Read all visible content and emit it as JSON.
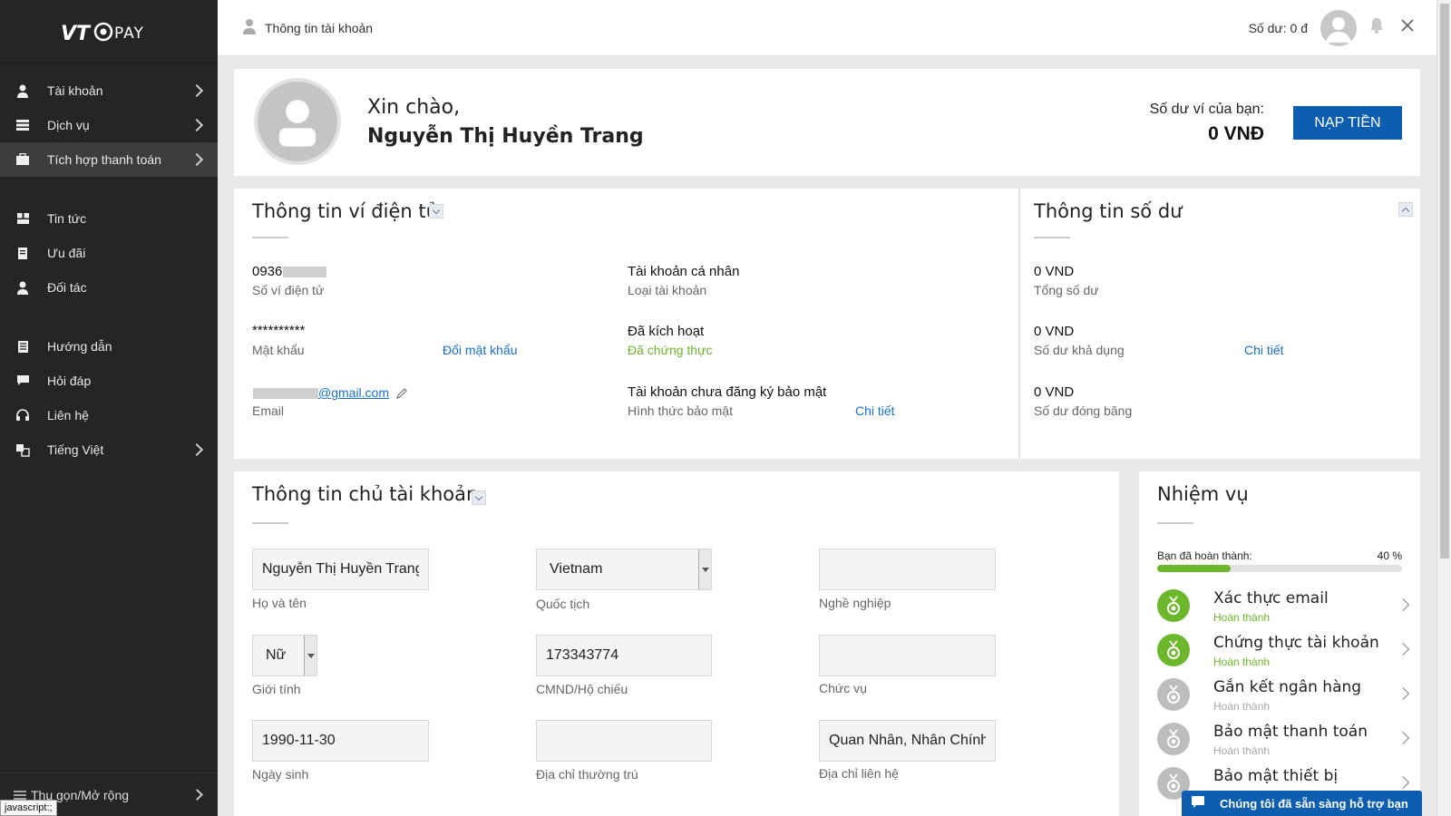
{
  "app": {
    "logo_text": "VTC PAY"
  },
  "sidebar": {
    "groups": [
      [
        {
          "label": "Tài khoản",
          "icon": "user-icon",
          "has_submenu": true
        },
        {
          "label": "Dịch vụ",
          "icon": "services-icon",
          "has_submenu": true
        },
        {
          "label": "Tích hợp thanh toán",
          "icon": "briefcase-icon",
          "has_submenu": true,
          "active": true
        }
      ],
      [
        {
          "label": "Tin tức",
          "icon": "news-icon"
        },
        {
          "label": "Ưu đãi",
          "icon": "coupon-icon"
        },
        {
          "label": "Đối tác",
          "icon": "partner-icon"
        }
      ],
      [
        {
          "label": "Hướng dẫn",
          "icon": "book-icon"
        },
        {
          "label": "Hỏi đáp",
          "icon": "chat-icon"
        },
        {
          "label": "Liên hệ",
          "icon": "headset-icon"
        },
        {
          "label": "Tiếng Việt",
          "icon": "language-icon",
          "has_submenu": true
        }
      ]
    ],
    "collapse_label": "Thu gọn/Mở rộng"
  },
  "status_bar": "javascript:;",
  "topbar": {
    "breadcrumb": "Thông tin tài khoản",
    "balance": "Số dư: 0 đ"
  },
  "welcome": {
    "greeting": "Xin chào,",
    "name": "Nguyễn Thị Huyền Trang",
    "wallet_label": "Số dư ví của bạn:",
    "wallet_value": "0 VNĐ",
    "topup_label": "NẠP TIỀN"
  },
  "wallet_info": {
    "title": "Thông tin ví điện tử",
    "phone_prefix": "0936",
    "phone_label": "Số ví điện tử",
    "password_value": "**********",
    "password_label": "Mật khẩu",
    "change_password_link": "Đổi mật khẩu",
    "email_suffix": "@gmail.com",
    "email_label": "Email",
    "account_type_value": "Tài khoản cá nhân",
    "account_type_label": "Loại tài khoản",
    "activation_value": "Đã kích hoạt",
    "activation_label": "Đã chứng thực",
    "security_value": "Tài khoản chưa đăng ký bảo mật",
    "security_label": "Hình thức bảo mật",
    "security_link": "Chi tiết"
  },
  "balance_info": {
    "title": "Thông tin số dư",
    "total_value": "0 VND",
    "total_label": "Tổng số dư",
    "available_value": "0 VND",
    "available_label": "Số dư khả dụng",
    "available_link": "Chi tiết",
    "frozen_value": "0 VND",
    "frozen_label": "Số dư đóng băng"
  },
  "owner_info": {
    "title": "Thông tin chủ tài khoản",
    "full_name_value": "Nguyễn Thị Huyền Trang",
    "full_name_label": "Họ và tên",
    "nationality_value": "Vietnam",
    "nationality_label": "Quốc tịch",
    "occupation_value": "",
    "occupation_label": "Nghề nghiệp",
    "gender_value": "Nữ",
    "gender_label": "Giới tính",
    "id_value": "173343774",
    "id_label": "CMND/Hộ chiếu",
    "position_value": "",
    "position_label": "Chức vụ",
    "dob_value": "1990-11-30",
    "dob_label": "Ngày sinh",
    "permanent_address_value": "",
    "permanent_address_label": "Địa chỉ thường trú",
    "contact_address_value": "Quan Nhân, Nhân Chính",
    "contact_address_label": "Địa chỉ liên hệ"
  },
  "tasks": {
    "title": "Nhiệm vụ",
    "progress_label": "Bạn đã hoàn thành:",
    "progress_text": "40 %",
    "progress_fraction": 0.3,
    "items": [
      {
        "name": "Xác thực email",
        "status": "Hoàn thành",
        "done": true
      },
      {
        "name": "Chứng thực tài khoản",
        "status": "Hoàn thành",
        "done": true
      },
      {
        "name": "Gắn kết ngân hàng",
        "status": "Hoàn thành",
        "done": false
      },
      {
        "name": "Bảo mật thanh toán",
        "status": "Hoàn thành",
        "done": false
      },
      {
        "name": "Bảo mật thiết bị",
        "status": "",
        "done": false
      }
    ]
  },
  "support": {
    "label": "Chúng tôi đã sẵn sàng hỗ trợ bạn"
  },
  "colors": {
    "accent": "#0d5eb0",
    "success": "#6cb72c",
    "sidebar": "#252525",
    "link": "#1a6fc9"
  }
}
